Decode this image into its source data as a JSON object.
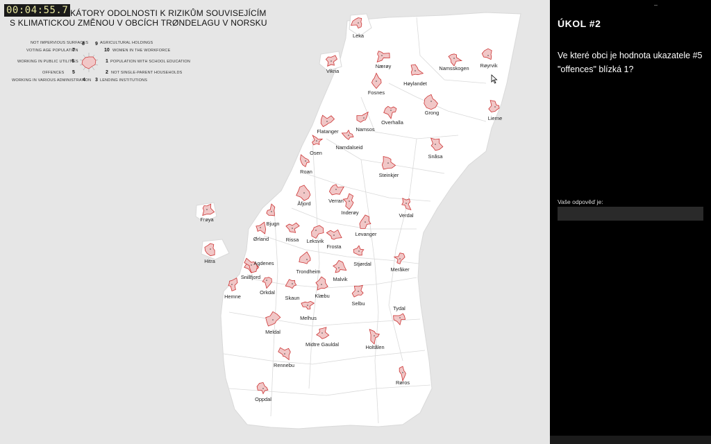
{
  "timer": "00:04:55.7",
  "map": {
    "title_line1": "VYBRANÉ INDIKÁTORY ODOLNOSTI K RIZIKŮM SOUVISEJÍCÍM",
    "title_line2": "S KLIMATICKOU ZMĚNOU V OBCÍCH TRØNDELAGU V NORSKU",
    "legend": [
      {
        "num": "8",
        "label": "NOT IMPERVIOUS SURFACES"
      },
      {
        "num": "9",
        "label": "AGRICULTURAL HOLDINGS"
      },
      {
        "num": "7",
        "label": "VOTING AGE POPULATION"
      },
      {
        "num": "10",
        "label": "WOMEN IN THE WORKFORCE"
      },
      {
        "num": "6",
        "label": "WORKING IN PUBLIC UTILITIES"
      },
      {
        "num": "1",
        "label": "POPULATION WITH SCHOOL EDUCATION"
      },
      {
        "num": "5",
        "label": "OFFENCES"
      },
      {
        "num": "2",
        "label": "NOT SINGLE-PARENT HOUSEHOLDS"
      },
      {
        "num": "4",
        "label": "WORKING IN VARIOUS ADMINISTRATION"
      },
      {
        "num": "3",
        "label": "LENDING INSTITUTIONS"
      }
    ],
    "municipalities": [
      "Leka",
      "Vikna",
      "Nærøy",
      "Høylandet",
      "Namsskogen",
      "Røyrvik",
      "Fosnes",
      "Grong",
      "Lierne",
      "Overhalla",
      "Flatanger",
      "Namsos",
      "Namdalseid",
      "Osen",
      "Snåsa",
      "Roan",
      "Steinkjer",
      "Åfjord",
      "Verran",
      "Inderøy",
      "Verdal",
      "Frøya",
      "Bjugn",
      "Ørland",
      "Rissa",
      "Leksvik",
      "Frosta",
      "Levanger",
      "Hitra",
      "Agdenes",
      "Trondheim",
      "Stjørdal",
      "Meråker",
      "Snillfjord",
      "Malvik",
      "Hemne",
      "Orkdal",
      "Skaun",
      "Klæbu",
      "Selbu",
      "Melhus",
      "Tydal",
      "Meldal",
      "Midtre Gauldal",
      "Holtålen",
      "Rennebu",
      "Røros",
      "Oppdal"
    ]
  },
  "panel": {
    "dash": "–",
    "task_title": "ÚKOL #2",
    "question": "Ve které obci je hodnota ukazatele #5 \"offences\" blízká 1?",
    "answer_label": "Vaše odpověď je:",
    "answer_value": "",
    "answer_placeholder": ""
  }
}
